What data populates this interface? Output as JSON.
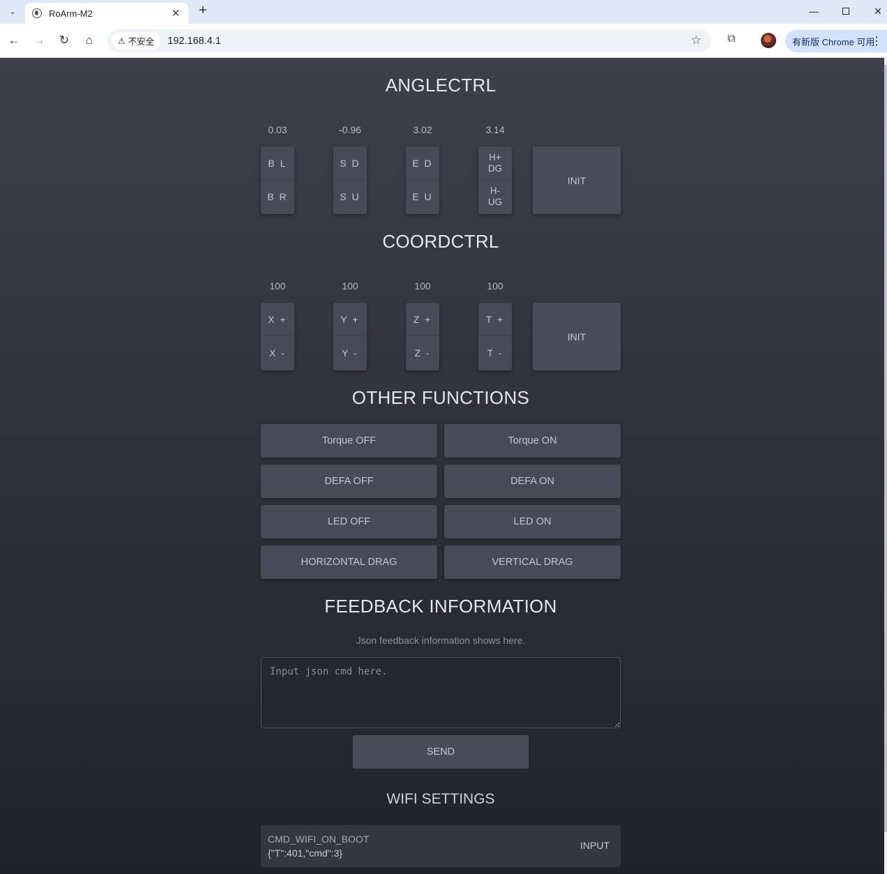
{
  "browser": {
    "tab_title": "RoArm-M2",
    "security_label": "不安全",
    "url": "192.168.4.1",
    "update_label": "有新版 Chrome 可用"
  },
  "angle_ctrl": {
    "title": "ANGLECTRL",
    "values": [
      "0.03",
      "-0.96",
      "3.02",
      "3.14"
    ],
    "buttons": [
      {
        "top": "B L",
        "bottom": "B R"
      },
      {
        "top": "S D",
        "bottom": "S U"
      },
      {
        "top": "E D",
        "bottom": "E U"
      },
      {
        "top": "H+\nDG",
        "bottom": "H-\nUG"
      }
    ],
    "init_label": "INIT"
  },
  "coord_ctrl": {
    "title": "COORDCTRL",
    "values": [
      "100",
      "100",
      "100",
      "100"
    ],
    "buttons": [
      {
        "top": "X +",
        "bottom": "X -"
      },
      {
        "top": "Y +",
        "bottom": "Y -"
      },
      {
        "top": "Z +",
        "bottom": "Z -"
      },
      {
        "top": "T +",
        "bottom": "T -"
      }
    ],
    "init_label": "INIT"
  },
  "other_functions": {
    "title": "OTHER FUNCTIONS",
    "buttons": [
      "Torque OFF",
      "Torque ON",
      "DEFA OFF",
      "DEFA ON",
      "LED OFF",
      "LED ON",
      "HORIZONTAL DRAG",
      "VERTICAL DRAG"
    ]
  },
  "feedback": {
    "title": "FEEDBACK INFORMATION",
    "text": "Json feedback information shows here.",
    "input_placeholder": "Input json cmd here.",
    "send_label": "SEND"
  },
  "wifi": {
    "title": "WIFI SETTINGS",
    "cmd_name": "CMD_WIFI_ON_BOOT",
    "cmd_json": "{\"T\":401,\"cmd\":3}",
    "input_label": "INPUT"
  }
}
